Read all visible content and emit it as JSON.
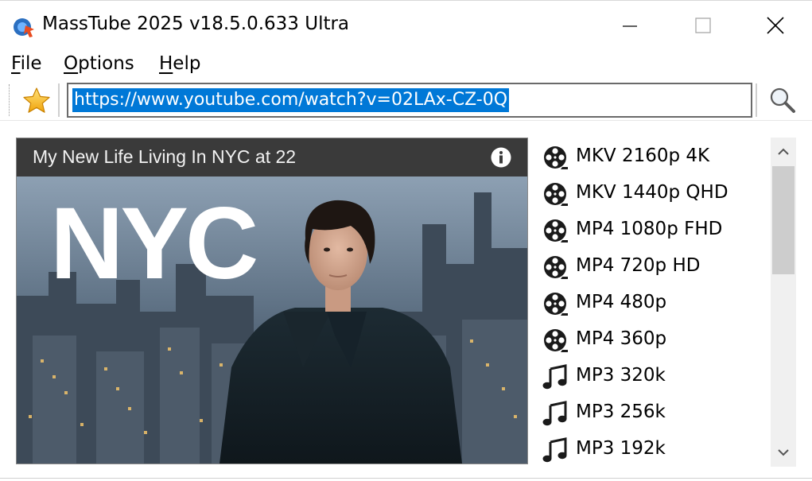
{
  "window": {
    "title": "MassTube 2025 v18.5.0.633 Ultra",
    "icon": "masstube-app-icon"
  },
  "menu": {
    "items": [
      {
        "label": "File",
        "accel": "F",
        "rest": "ile"
      },
      {
        "label": "Options",
        "accel": "O",
        "rest": "ptions"
      },
      {
        "label": "Help",
        "accel": "H",
        "rest": "elp"
      }
    ]
  },
  "toolbar": {
    "url": "https://www.youtube.com/watch?v=02LAx-CZ-0Q",
    "favorite_icon": "star-icon",
    "search_icon": "magnifier-icon"
  },
  "video": {
    "title": "My New Life Living In NYC at 22",
    "thumbnail_text": "NYC"
  },
  "formats": [
    {
      "label": "MKV 2160p 4K",
      "icon": "film-reel-icon"
    },
    {
      "label": "MKV 1440p QHD",
      "icon": "film-reel-icon"
    },
    {
      "label": "MP4 1080p FHD",
      "icon": "film-reel-icon"
    },
    {
      "label": "MP4 720p HD",
      "icon": "film-reel-icon"
    },
    {
      "label": "MP4 480p",
      "icon": "film-reel-icon"
    },
    {
      "label": "MP4 360p",
      "icon": "film-reel-icon"
    },
    {
      "label": "MP3 320k",
      "icon": "music-note-icon"
    },
    {
      "label": "MP3 256k",
      "icon": "music-note-icon"
    },
    {
      "label": "MP3 192k",
      "icon": "music-note-icon"
    }
  ],
  "colors": {
    "selection": "#0078d7",
    "video_header": "#3a3a3a",
    "star": "#f5b81c"
  }
}
